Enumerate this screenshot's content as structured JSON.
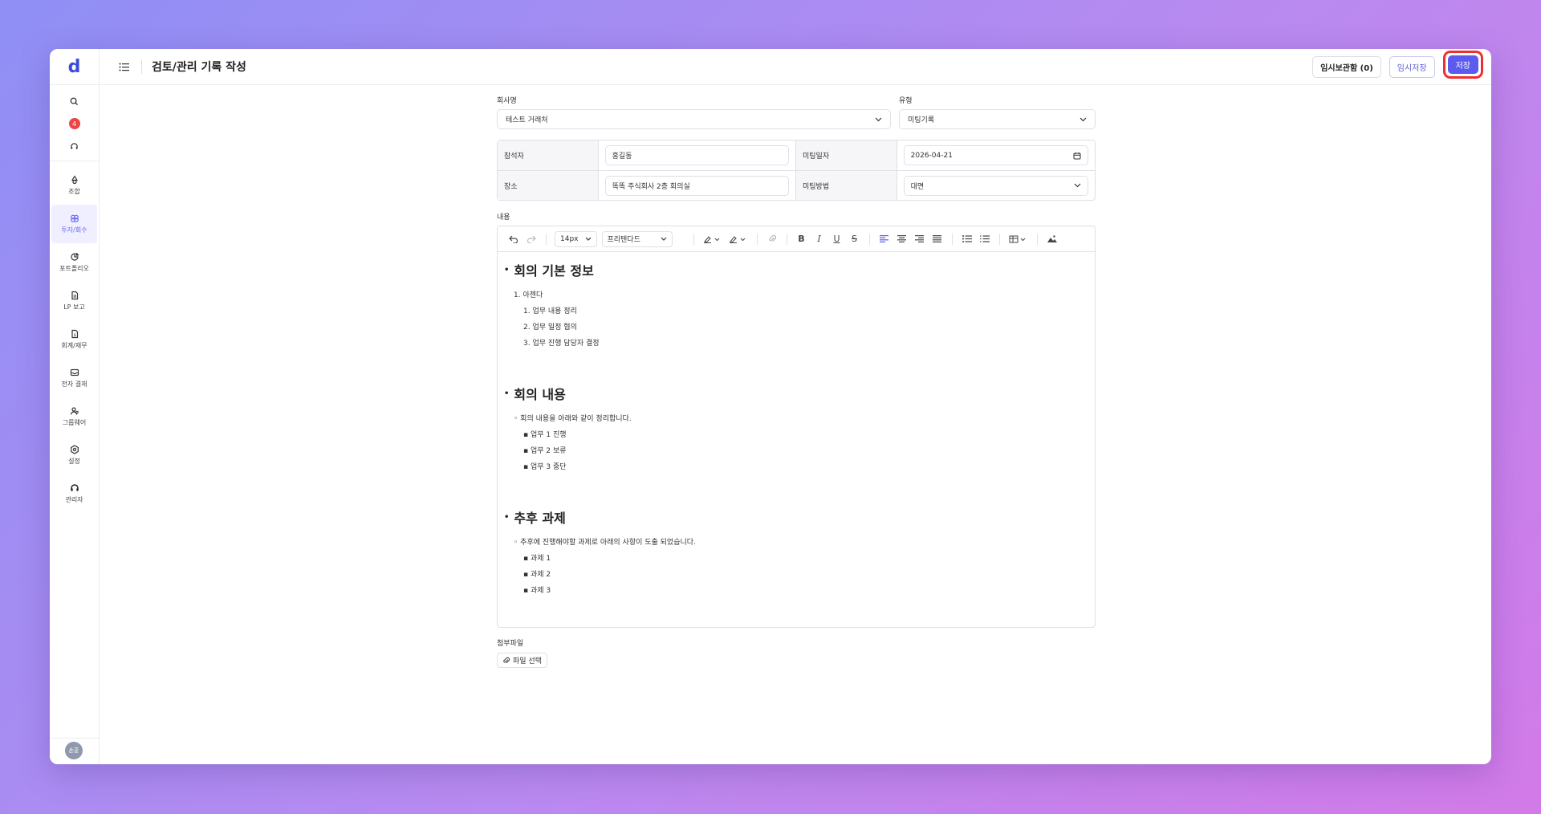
{
  "app": {
    "logo": "d"
  },
  "sidebar": {
    "notification_count": "4",
    "items": [
      {
        "label": "조합",
        "icon": "recycle-icon"
      },
      {
        "label": "투자/회수",
        "icon": "infinity-icon"
      },
      {
        "label": "포트폴리오",
        "icon": "pie-chart-icon"
      },
      {
        "label": "LP 보고",
        "icon": "document-icon"
      },
      {
        "label": "회계/재무",
        "icon": "ledger-icon"
      },
      {
        "label": "전자 결재",
        "icon": "inbox-icon"
      },
      {
        "label": "그룹웨어",
        "icon": "users-icon"
      },
      {
        "label": "설정",
        "icon": "settings-icon"
      },
      {
        "label": "관리자",
        "icon": "headset-icon"
      }
    ],
    "avatar_initials": "손훈"
  },
  "header": {
    "title": "검토/관리 기록 작성",
    "temp_storage_label": "임시보관함 (0)",
    "temp_save_label": "임시저장",
    "save_label": "저장"
  },
  "form": {
    "company_label": "회사명",
    "company_value": "테스트 거래처",
    "type_label": "유형",
    "type_value": "미팅기록",
    "attendees_label": "참석자",
    "attendees_value": "홍길동",
    "meeting_date_label": "미팅일자",
    "meeting_date_value": "2026-04-21",
    "place_label": "장소",
    "place_value": "똑똑 주식회사 2층 회의실",
    "meeting_method_label": "미팅방법",
    "meeting_method_value": "대면",
    "content_label": "내용",
    "attachment_label": "첨부파일",
    "file_select_label": "파일 선택"
  },
  "editor_toolbar": {
    "font_size": "14px",
    "font_family": "프리텐다드"
  },
  "editor": {
    "sections": [
      {
        "heading": "회의 기본 정보",
        "lines": [
          {
            "level": 1,
            "text": "1. 아젠다"
          },
          {
            "level": 2,
            "text": "1. 업무 내용 정리"
          },
          {
            "level": 2,
            "text": "2. 업무 일정 협의"
          },
          {
            "level": 2,
            "text": "3. 업무 진행 담당자 결정"
          }
        ]
      },
      {
        "heading": "회의 내용",
        "lines": [
          {
            "level": 1,
            "text": "◦  회의 내용을 아래와 같이 정리합니다."
          },
          {
            "level": 2,
            "text": "▪  업무 1 진행"
          },
          {
            "level": 2,
            "text": "▪  업무 2 보류"
          },
          {
            "level": 2,
            "text": "▪  업무 3 중단"
          }
        ]
      },
      {
        "heading": "추후 과제",
        "lines": [
          {
            "level": 1,
            "text": "◦  추후에 진행해야할 과제로 아래의 사항이 도출 되었습니다."
          },
          {
            "level": 2,
            "text": "▪  과제 1"
          },
          {
            "level": 2,
            "text": "▪  과제 2"
          },
          {
            "level": 2,
            "text": "▪  과제 3"
          }
        ]
      }
    ]
  },
  "colors": {
    "accent": "#5b5bef",
    "highlight_ring": "#ef2f2f",
    "badge": "#ef4444"
  }
}
